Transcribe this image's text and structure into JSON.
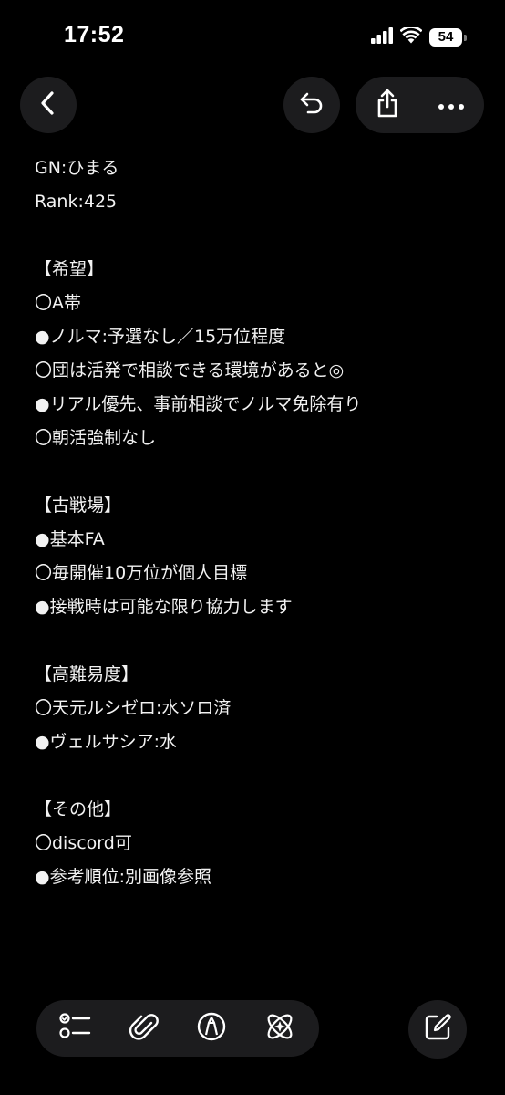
{
  "status_bar": {
    "time": "17:52",
    "battery_level": "54",
    "icons": [
      "signal-icon",
      "wifi-icon",
      "battery-icon"
    ]
  },
  "toolbar": {
    "icons": [
      "back-chevron-icon",
      "undo-icon",
      "share-icon",
      "more-icon"
    ]
  },
  "note": {
    "lines": [
      "GN:ひまる",
      "Rank:425",
      "",
      "【希望】",
      "〇A帯",
      "●ノルマ:予選なし／15万位程度",
      "〇団は活発で相談できる環境があると◎",
      "●リアル優先、事前相談でノルマ免除有り",
      "〇朝活強制なし",
      "",
      "【古戦場】",
      "●基本FA",
      "〇毎開催10万位が個人目標",
      "●接戦時は可能な限り協力します",
      "",
      "【高難易度】",
      "〇天元ルシゼロ:水ソロ済",
      "●ヴェルサシア:水",
      "",
      "【その他】",
      "〇discord可",
      "●参考順位:別画像参照"
    ]
  },
  "bottom_toolbar": {
    "icons": [
      "checklist-icon",
      "paperclip-icon",
      "markup-pen-icon",
      "writing-tools-icon",
      "compose-icon"
    ]
  },
  "colors": {
    "background": "#000000",
    "button_bg": "#1c1c1e",
    "text": "#f2f2f2"
  }
}
